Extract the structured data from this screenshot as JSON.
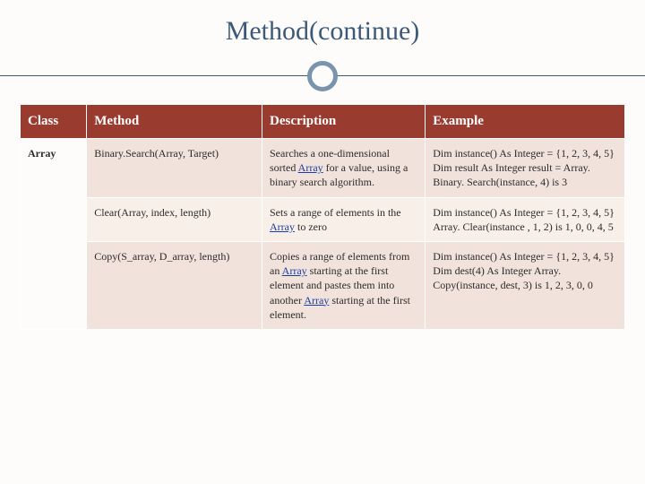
{
  "title": "Method(continue)",
  "headers": {
    "class": "Class",
    "method": "Method",
    "description": "Description",
    "example": "Example"
  },
  "class_label": "Array",
  "rows": [
    {
      "method": "Binary.Search(Array, Target)",
      "desc_pre": "Searches a one-dimensional sorted ",
      "desc_link": "Array",
      "desc_post": " for a value, using a binary search algorithm.",
      "example": "Dim instance() As Integer = {1, 2, 3, 4, 5}\nDim result As Integer\n result = Array. Binary. Search(instance, 4) is 3"
    },
    {
      "method": "Clear(Array, index, length)",
      "desc_pre": "Sets a range of elements in the ",
      "desc_link": "Array",
      "desc_post": " to zero",
      "example": " Dim instance() As Integer = {1, 2, 3, 4, 5}\nArray. Clear(instance , 1, 2) is 1, 0, 0, 4, 5"
    },
    {
      "method": "Copy(S_array, D_array, length)",
      "desc_pre": "Copies a range of elements from an ",
      "desc_link": "Array",
      "desc_mid": " starting at the first element and pastes them into another ",
      "desc_link2": "Array",
      "desc_post": " starting at the first element.",
      "example": " Dim instance() As Integer = {1, 2, 3, 4, 5}\n Dim dest(4) As Integer\nArray. Copy(instance, dest, 3) is 1, 2, 3, 0, 0"
    }
  ]
}
